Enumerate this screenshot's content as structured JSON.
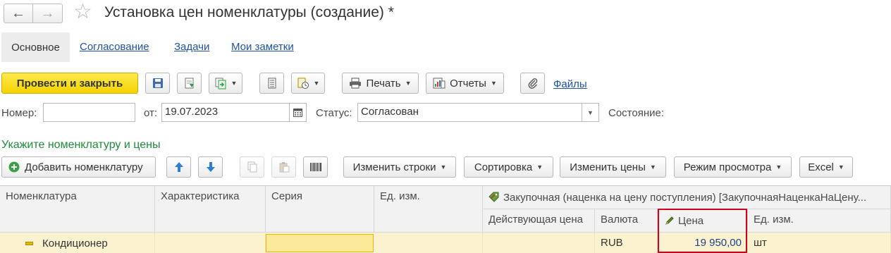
{
  "window": {
    "title": "Установка цен номенклатуры (создание) *"
  },
  "nav": {
    "back_icon": "arrow-left-icon",
    "forward_icon": "arrow-right-icon",
    "favorite_icon": "star-icon"
  },
  "tabs": [
    {
      "label": "Основное",
      "active": true
    },
    {
      "label": "Согласование",
      "active": false
    },
    {
      "label": "Задачи",
      "active": false
    },
    {
      "label": "Мои заметки",
      "active": false
    }
  ],
  "toolbar": {
    "post_close_label": "Провести и закрыть",
    "print_label": "Печать",
    "reports_label": "Отчеты",
    "files_label": "Файлы"
  },
  "form": {
    "number_label": "Номер:",
    "number_value": "",
    "date_label": "от:",
    "date_value": "19.07.2023",
    "status_label": "Статус:",
    "status_value": "Согласован",
    "state_label": "Состояние:"
  },
  "section": {
    "title": "Укажите номенклатуру и цены"
  },
  "table_toolbar": {
    "add_label": "Добавить номенклатуру",
    "change_rows_label": "Изменить строки",
    "sort_label": "Сортировка",
    "change_prices_label": "Изменить цены",
    "view_mode_label": "Режим просмотра",
    "excel_label": "Excel"
  },
  "table": {
    "columns": {
      "nomenclature": "Номенклатура",
      "characteristic": "Характеристика",
      "series": "Серия",
      "unit": "Ед. изм.",
      "price_type_group": "Закупочная (наценка на цену поступления) [ЗакупочнаяНаценкаНаЦену...",
      "current_price": "Действующая цена",
      "currency": "Валюта",
      "price": "Цена",
      "price_unit": "Ед. изм."
    },
    "rows": [
      {
        "nomenclature": "Кондиционер",
        "characteristic": "",
        "series": "",
        "unit": "",
        "current_price": "",
        "currency": "RUB",
        "price": "19 950,00",
        "price_unit": "шт"
      }
    ]
  },
  "colors": {
    "primary_button": "#f5d300",
    "link": "#1e52a3",
    "section_title": "#1e8c3a",
    "row_highlight": "#fbf3d0",
    "focus_frame": "#d0021b"
  }
}
